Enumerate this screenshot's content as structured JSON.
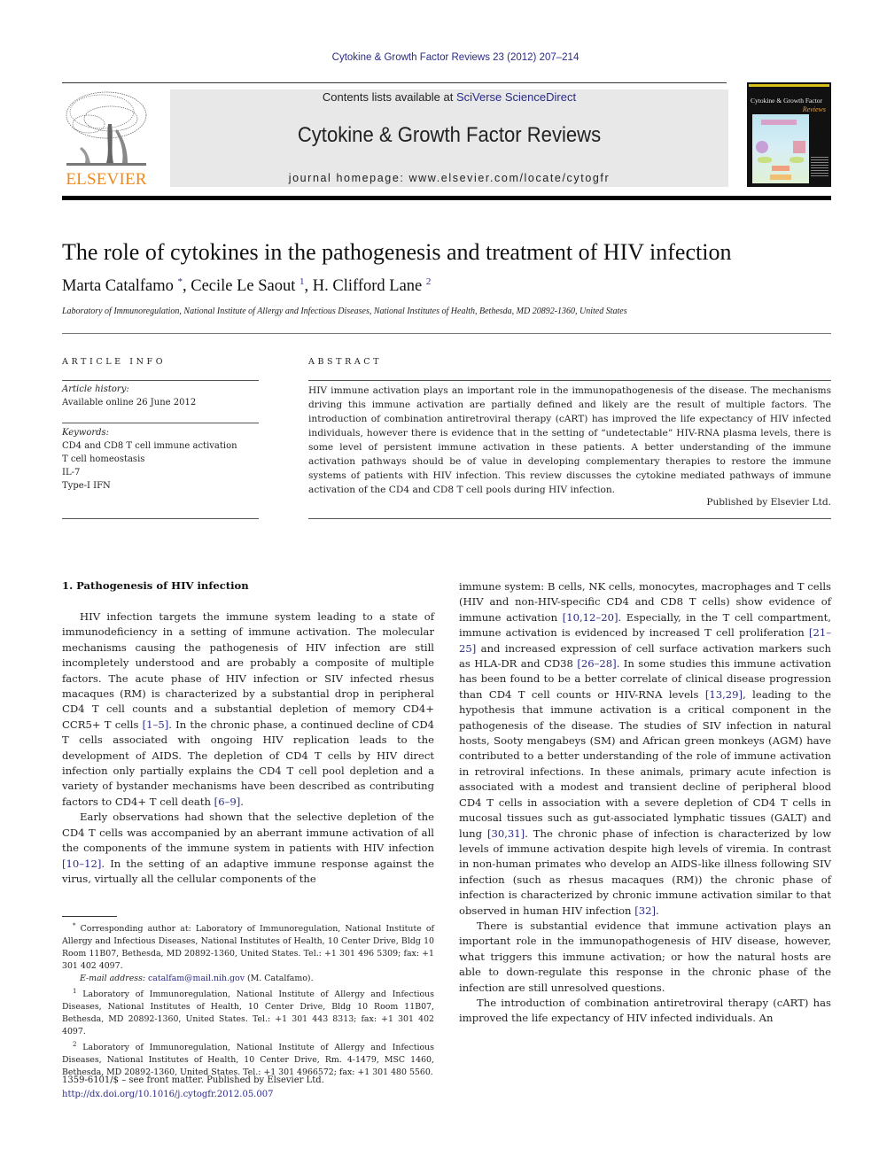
{
  "header": {
    "journal_ref": "Cytokine & Growth Factor Reviews 23 (2012) 207–214",
    "publisher_logo_text": "ELSEVIER",
    "contents_prefix": "Contents lists available at ",
    "contents_link": "SciVerse ScienceDirect",
    "journal_name": "Cytokine & Growth Factor Reviews",
    "homepage": "journal homepage: www.elsevier.com/locate/cytogfr",
    "cover_title": "Cytokine & Growth Factor",
    "cover_subtitle": "Reviews"
  },
  "article": {
    "title": "The role of cytokines in the pathogenesis and treatment of HIV infection",
    "authors": [
      {
        "name": "Marta Catalfamo",
        "mark": "*"
      },
      {
        "name": "Cecile Le Saout",
        "mark": "1"
      },
      {
        "name": "H. Clifford Lane",
        "mark": "2"
      }
    ],
    "author_sep": ", ",
    "affiliation": "Laboratory of Immunoregulation, National Institute of Allergy and Infectious Diseases, National Institutes of Health, Bethesda, MD 20892-1360, United States"
  },
  "article_info": {
    "heading": "ARTICLE INFO",
    "history_label": "Article history:",
    "history_value": "Available online 26 June 2012",
    "keywords_label": "Keywords:",
    "keywords": [
      "CD4 and CD8 T cell immune activation",
      "T cell homeostasis",
      "IL-7",
      "Type-I IFN"
    ]
  },
  "abstract": {
    "heading": "ABSTRACT",
    "text": "HIV immune activation plays an important role in the immunopathogenesis of the disease. The mechanisms driving this immune activation are partially defined and likely are the result of multiple factors. The introduction of combination antiretroviral therapy (cART) has improved the life expectancy of HIV infected individuals, however there is evidence that in the setting of “undetectable” HIV-RNA plasma levels, there is some level of persistent immune activation in these patients. A better understanding of the immune activation pathways should be of value in developing complementary therapies to restore the immune systems of patients with HIV infection. This review discusses the cytokine mediated pathways of immune activation of the CD4 and CD8 T cell pools during HIV infection.",
    "published_by": "Published by Elsevier Ltd."
  },
  "body": {
    "section1_heading": "1.  Pathogenesis of HIV infection",
    "left": {
      "p1": [
        {
          "t": "HIV infection targets the immune system leading to a state of immunodeficiency in a setting of immune activation. The molecular mechanisms causing the pathogenesis of HIV infection are still incompletely understood and are probably a composite of multiple factors. The acute phase of HIV infection or SIV infected rhesus macaques (RM) is characterized by a substantial drop in peripheral CD4 T cell counts and a substantial depletion of memory CD4+ CCR5+ T cells "
        },
        {
          "ref": "[1–5]"
        },
        {
          "t": ". In the chronic phase, a continued decline of CD4 T cells associated with ongoing HIV replication leads to the development of AIDS. The depletion of CD4 T cells by HIV direct infection only partially explains the CD4 T cell pool depletion and a variety of bystander mechanisms have been described as contributing factors to CD4+ T cell death "
        },
        {
          "ref": "[6–9]"
        },
        {
          "t": "."
        }
      ],
      "p2": [
        {
          "t": "Early observations had shown that the selective depletion of the CD4 T cells was accompanied by an aberrant immune activation of all the components of the immune system in patients with HIV infection "
        },
        {
          "ref": "[10–12]"
        },
        {
          "t": ". In the setting of an adaptive immune response against the virus, virtually all the cellular components of the"
        }
      ]
    },
    "right": {
      "p1": [
        {
          "t": "immune system: B cells, NK cells, monocytes, macrophages and T cells (HIV and non-HIV-specific CD4 and CD8 T cells) show evidence of immune activation "
        },
        {
          "ref": "[10,12–20]"
        },
        {
          "t": ". Especially, in the T cell compartment, immune activation is evidenced by increased T cell proliferation "
        },
        {
          "ref": "[21–25]"
        },
        {
          "t": " and increased expression of cell surface activation markers such as HLA-DR and CD38 "
        },
        {
          "ref": "[26–28]"
        },
        {
          "t": ". In some studies this immune activation has been found to be a better correlate of clinical disease progression than CD4 T cell counts or HIV-RNA levels "
        },
        {
          "ref": "[13,29]"
        },
        {
          "t": ", leading to the hypothesis that immune activation is a critical component in the pathogenesis of the disease. The studies of SIV infection in natural hosts, Sooty mengabeys (SM) and African green monkeys (AGM) have contributed to a better understanding of the role of immune activation in retroviral infections. In these animals, primary acute infection is associated with a modest and transient decline of peripheral blood CD4 T cells in association with a severe depletion of CD4 T cells in mucosal tissues such as gut-associated lymphatic tissues (GALT) and lung "
        },
        {
          "ref": "[30,31]"
        },
        {
          "t": ". The chronic phase of infection is characterized by low levels of immune activation despite high levels of viremia. In contrast in non-human primates who develop an AIDS-like illness following SIV infection (such as rhesus macaques (RM)) the chronic phase of infection is characterized by chronic immune activation similar to that observed in human HIV infection "
        },
        {
          "ref": "[32]"
        },
        {
          "t": "."
        }
      ],
      "p2": [
        {
          "t": "There is substantial evidence that immune activation plays an important role in the immunopathogenesis of HIV disease, however, what triggers this immune activation; or how the natural hosts are able to down-regulate this response in the chronic phase of the infection are still unresolved questions."
        }
      ],
      "p3": [
        {
          "t": "The introduction of combination antiretroviral therapy (cART) has improved the life expectancy of HIV infected individuals. An"
        }
      ]
    }
  },
  "footnotes": {
    "corresponding_mark": "*",
    "corresponding": "Corresponding author at: Laboratory of Immunoregulation, National Institute of Allergy and Infectious Diseases, National Institutes of Health, 10 Center Drive, Bldg 10 Room 11B07, Bethesda, MD 20892-1360, United States. Tel.: +1 301 496 5309; fax: +1 301 402 4097.",
    "email_label": "E-mail address: ",
    "email": "catalfam@mail.nih.gov",
    "email_suffix": " (M. Catalfamo).",
    "fn1_mark": "1",
    "fn1": "Laboratory of Immunoregulation, National Institute of Allergy and Infectious Diseases, National Institutes of Health, 10 Center Drive, Bldg 10 Room 11B07, Bethesda, MD 20892-1360, United States. Tel.: +1 301 443 8313; fax: +1 301 402 4097.",
    "fn2_mark": "2",
    "fn2": "Laboratory of Immunoregulation, National Institute of Allergy and Infectious Diseases, National Institutes of Health, 10 Center Drive, Rm. 4-1479, MSC 1460, Bethesda, MD 20892-1360, United States. Tel.: +1 301 4966572; fax: +1 301 480 5560."
  },
  "front_matter": {
    "issn_line": "1359-6101/$ – see front matter. Published by Elsevier Ltd.",
    "doi": "http://dx.doi.org/10.1016/j.cytogfr.2012.05.007"
  },
  "colors": {
    "link": "#2a2a8a",
    "elsevier_orange": "#f08a1c",
    "banner_bg": "#e8e8e8"
  }
}
